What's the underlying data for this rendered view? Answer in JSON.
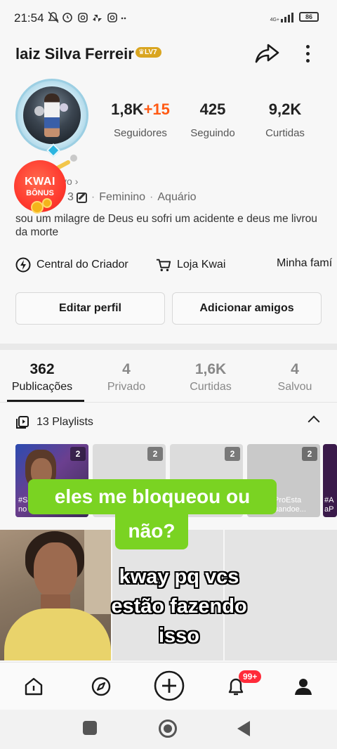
{
  "status_bar": {
    "time": "21:54",
    "icons": [
      "mute-icon",
      "alarm-icon",
      "instagram-icon",
      "pinwheel-icon",
      "instagram-icon",
      "more-dots"
    ],
    "network": "4G+",
    "battery": "86"
  },
  "profile": {
    "username": "laiz Silva Ferreir",
    "level_badge": "LV7",
    "link_fragment": "vo",
    "meta_number": "3",
    "gender": "Feminino",
    "sign": "Aquário",
    "bio": "sou um milagre de Deus eu sofri um acidente e deus me livrou da morte"
  },
  "stats": [
    {
      "value": "1,8K",
      "extra": "+15",
      "label": "Seguidores"
    },
    {
      "value": "425",
      "extra": "",
      "label": "Seguindo"
    },
    {
      "value": "9,2K",
      "extra": "",
      "label": "Curtidas"
    }
  ],
  "kwai_bonus": {
    "line1": "KWAI",
    "line2": "BÔNUS"
  },
  "quick_links": [
    {
      "label": "Central do Criador",
      "icon": "lightning-icon"
    },
    {
      "label": "Loja Kwai",
      "icon": "cart-icon"
    },
    {
      "label": "Minha famí",
      "icon": ""
    }
  ],
  "buttons": {
    "edit_profile": "Editar perfil",
    "add_friends": "Adicionar amigos"
  },
  "tabs": [
    {
      "count": "362",
      "label": "Publicações",
      "active": true
    },
    {
      "count": "4",
      "label": "Privado",
      "active": false
    },
    {
      "count": "1,6K",
      "label": "Curtidas",
      "active": false
    },
    {
      "count": "4",
      "label": "Salvou",
      "active": false
    }
  ],
  "playlists": {
    "header": "13 Playlists",
    "items": [
      {
        "count": "2",
        "caption": "#S\nno"
      },
      {
        "count": "2",
        "caption": ""
      },
      {
        "count": "2",
        "caption": ""
      },
      {
        "count": "2",
        "caption": "ProEsta\nuandoe..."
      },
      {
        "count": "",
        "caption": "#A\naP"
      }
    ]
  },
  "overlay": {
    "green_line1": "eles me bloqueou ou",
    "green_line2": "não?",
    "caption_line1": "kway pq vcs",
    "caption_line2": "estão fazendo",
    "caption_line3": "isso"
  },
  "bottom_nav": {
    "items": [
      "home-icon",
      "discover-icon",
      "create-icon",
      "notifications-icon",
      "profile-icon"
    ],
    "notification_badge": "99+"
  },
  "colors": {
    "accent_orange": "#ff5a14",
    "green_caption": "#7ad322",
    "badge_red": "#ff2b3a",
    "level_gold": "#d9a520"
  }
}
